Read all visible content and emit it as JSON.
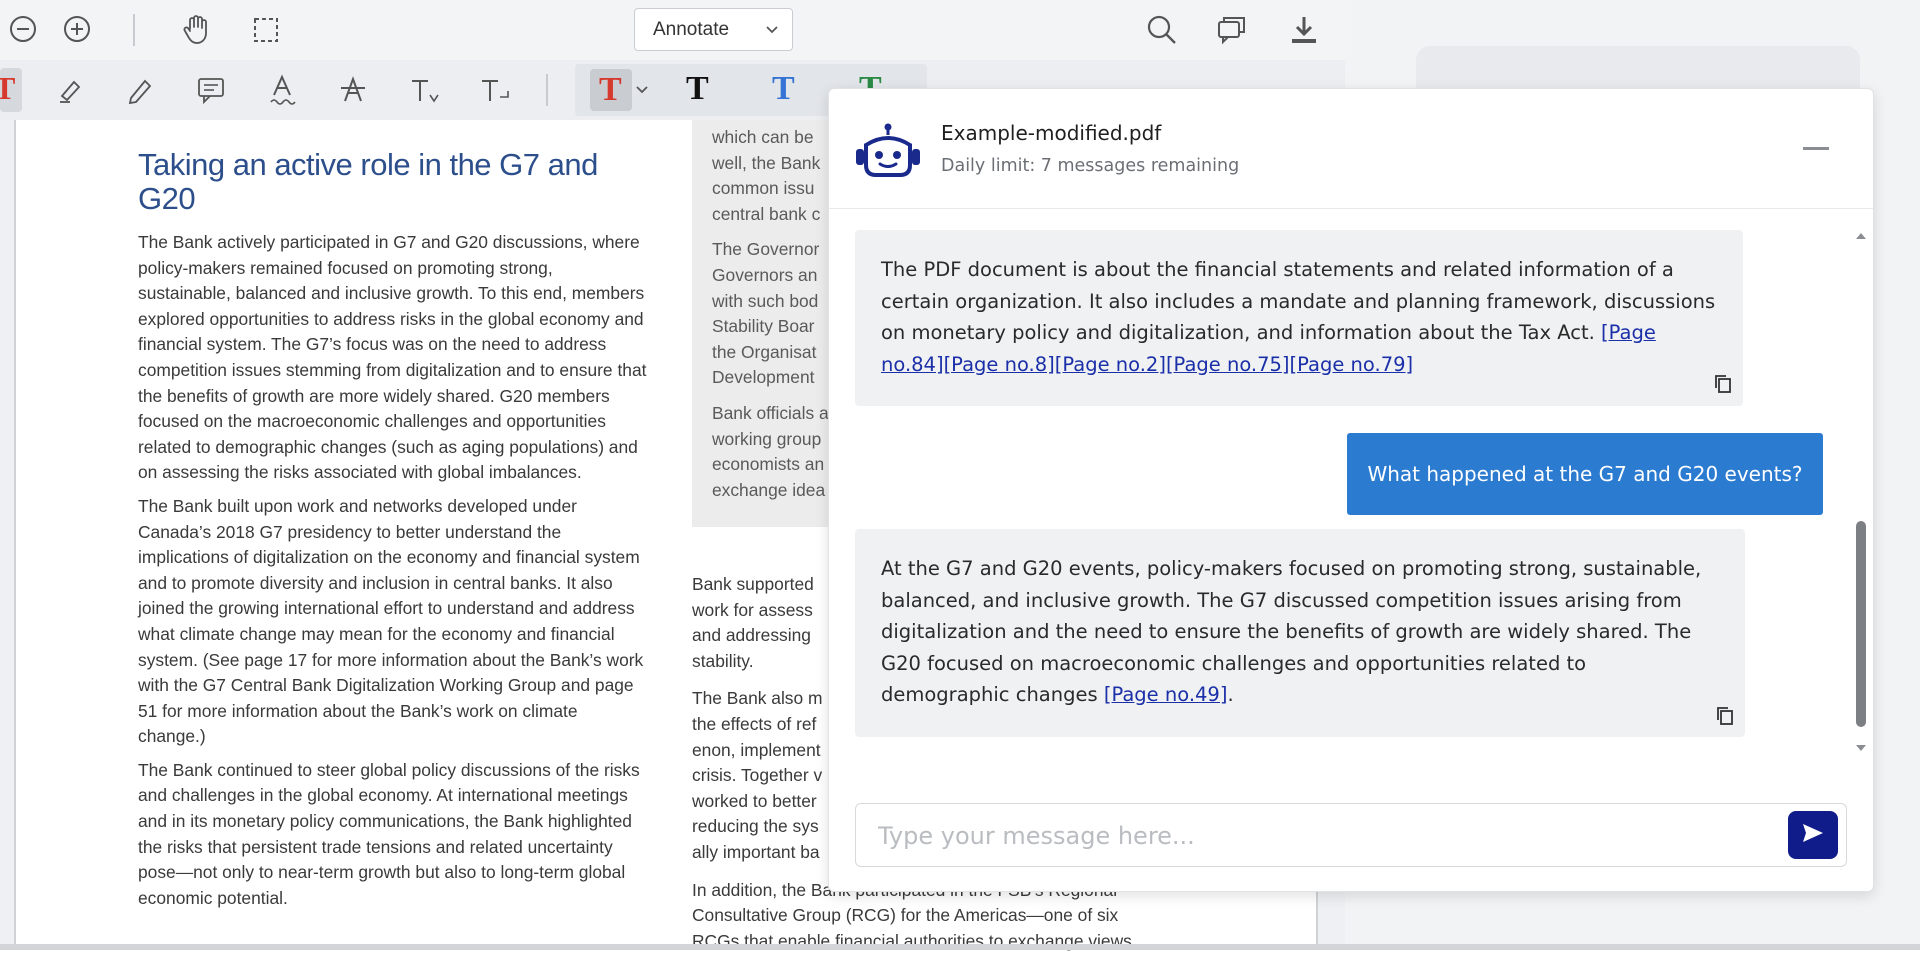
{
  "toolbar": {
    "annotate_label": "Annotate"
  },
  "document": {
    "heading": "Taking an active role in the G7 and G20",
    "paragraphs": [
      "The Bank actively participated in G7 and G20 discussions, where policy-makers remained focused on promoting strong, sustainable, balanced and inclusive growth. To this end, members explored opportunities to address risks in the global economy and financial system. The G7’s focus was on the need to address competition issues stemming from digitalization and to ensure that the benefits of growth are more widely shared. G20 members focused on the macroeconomic challenges and opportunities related to demographic changes (such as aging populations) and on assessing the risks associated with global imbalances.",
      "The Bank built upon work and networks developed under Canada’s 2018 G7 presidency to better understand the implications of digitalization on the economy and financial system and to promote diversity and inclusion in central banks. It also joined the growing international effort to understand and address what climate change may mean for the economy and financial system. (See page 17 for more information about the Bank’s work with the G7 Central Bank Digitalization Working Group and page 51 for more information about the Bank’s work on climate change.)",
      "The Bank continued to steer global policy discussions of the risks and challenges in the global economy. At international meetings and in its monetary policy communications, the Bank highlighted the risks that persistent trade tensions and related uncertainty pose—not only to near-term growth but also to long-term global economic potential."
    ],
    "sidebox_lines": [
      "which can be",
      "well, the Bank",
      "common issu",
      "central bank c",
      "",
      "The Governor",
      "Governors an",
      "with such bod",
      "Stability Boar",
      "the Organisat",
      "Development",
      "",
      "Bank officials a",
      "working group",
      "economists an",
      "exchange idea"
    ],
    "col2_lines": [
      "Bank supported",
      "work for assess",
      "and addressing",
      "stability.",
      "",
      "The Bank also m",
      "the effects of ref",
      "enon, implement",
      "crisis. Together v",
      "worked to better",
      "reducing the sys",
      "ally important ba",
      "",
      "In addition, the Bank participated in the FSB’s Regional",
      "Consultative Group (RCG) for the Americas—one of six",
      "RCGs that enable financial authorities to exchange views"
    ]
  },
  "chat": {
    "file_name": "Example-modified.pdf",
    "limit_text": "Daily limit: 7 messages remaining",
    "messages": [
      {
        "role": "assistant",
        "text": "The PDF document is about the financial statements and related information of a certain organization. It also includes a mandate and planning framework, discussions on monetary policy and digitalization, and information about the Tax Act.",
        "refs": [
          "[Page no.84]",
          "[Page no.8]",
          "[Page no.2]",
          "[Page no.75]",
          "[Page no.79]"
        ]
      },
      {
        "role": "user",
        "text": "What happened at the G7 and G20 events?"
      },
      {
        "role": "assistant",
        "text": "At the G7 and G20 events, policy-makers focused on promoting strong, sustainable, balanced, and inclusive growth. The G7 discussed competition issues arising from digitalization and the need to ensure the benefits of growth are widely shared. The G20 focused on macroeconomic challenges and opportunities related to demographic changes",
        "refs": [
          "[Page no.49]"
        ],
        "trailing": "."
      }
    ],
    "input_placeholder": "Type your message here..."
  },
  "colors": {
    "accent_blue": "#2b7bd1",
    "send_button": "#0f1c8a",
    "link": "#1a2fa8",
    "heading_blue": "#2c4f8c"
  }
}
